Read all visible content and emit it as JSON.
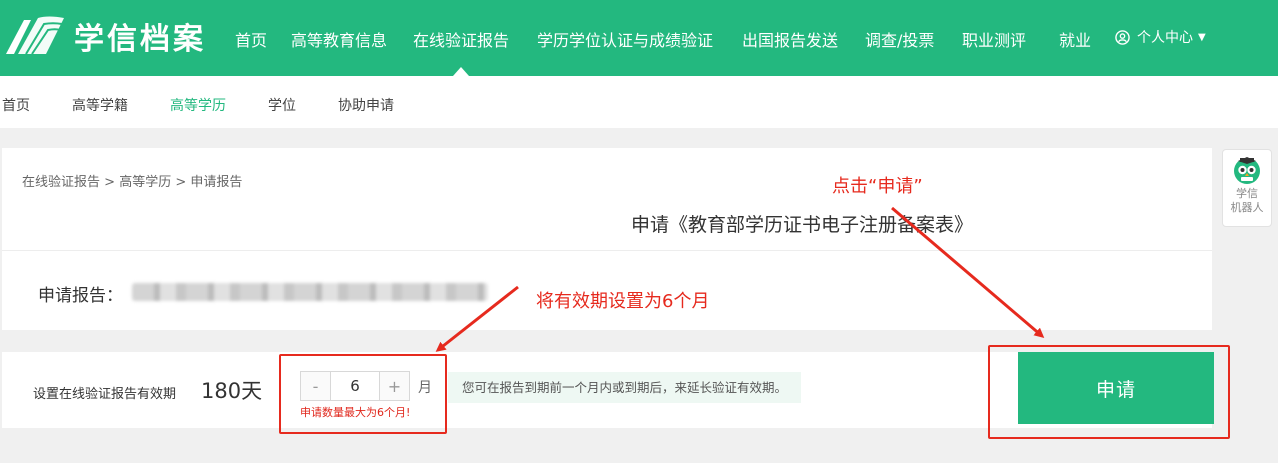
{
  "site": {
    "title": "学信档案"
  },
  "topnav": {
    "items": [
      {
        "label": "首页"
      },
      {
        "label": "高等教育信息"
      },
      {
        "label": "在线验证报告"
      },
      {
        "label": "学历学位认证与成绩验证"
      },
      {
        "label": "出国报告发送"
      },
      {
        "label": "调查/投票"
      },
      {
        "label": "职业测评"
      },
      {
        "label": "就业"
      }
    ],
    "active": "在线验证报告",
    "user_center": "个人中心"
  },
  "subnav": {
    "items": [
      {
        "label": "首页"
      },
      {
        "label": "高等学籍"
      },
      {
        "label": "高等学历"
      },
      {
        "label": "学位"
      },
      {
        "label": "协助申请"
      }
    ],
    "active": "高等学历"
  },
  "breadcrumb": {
    "items": [
      "在线验证报告",
      "高等学历",
      "申请报告"
    ],
    "separator": " > "
  },
  "form": {
    "title": "申请《教育部学历证书电子注册备案表》",
    "report_label": "申请报告：",
    "validity_label": "设置在线验证报告有效期",
    "validity_days": "180天",
    "stepper": {
      "minus": "-",
      "value": "6",
      "plus": "+"
    },
    "unit": "月",
    "error": "申请数量最大为6个月!",
    "hint": "您可在报告到期前一个月内或到期后，来延长验证有效期。",
    "apply_label": "申请"
  },
  "robot": {
    "line1": "学信",
    "line2": "机器人"
  },
  "annotations": {
    "click_apply": "点击“申请”",
    "set_validity": "将有效期设置为6个月"
  },
  "colors": {
    "brand": "#23b87f",
    "annotation": "#e62a1e",
    "error": "#e0261b"
  }
}
